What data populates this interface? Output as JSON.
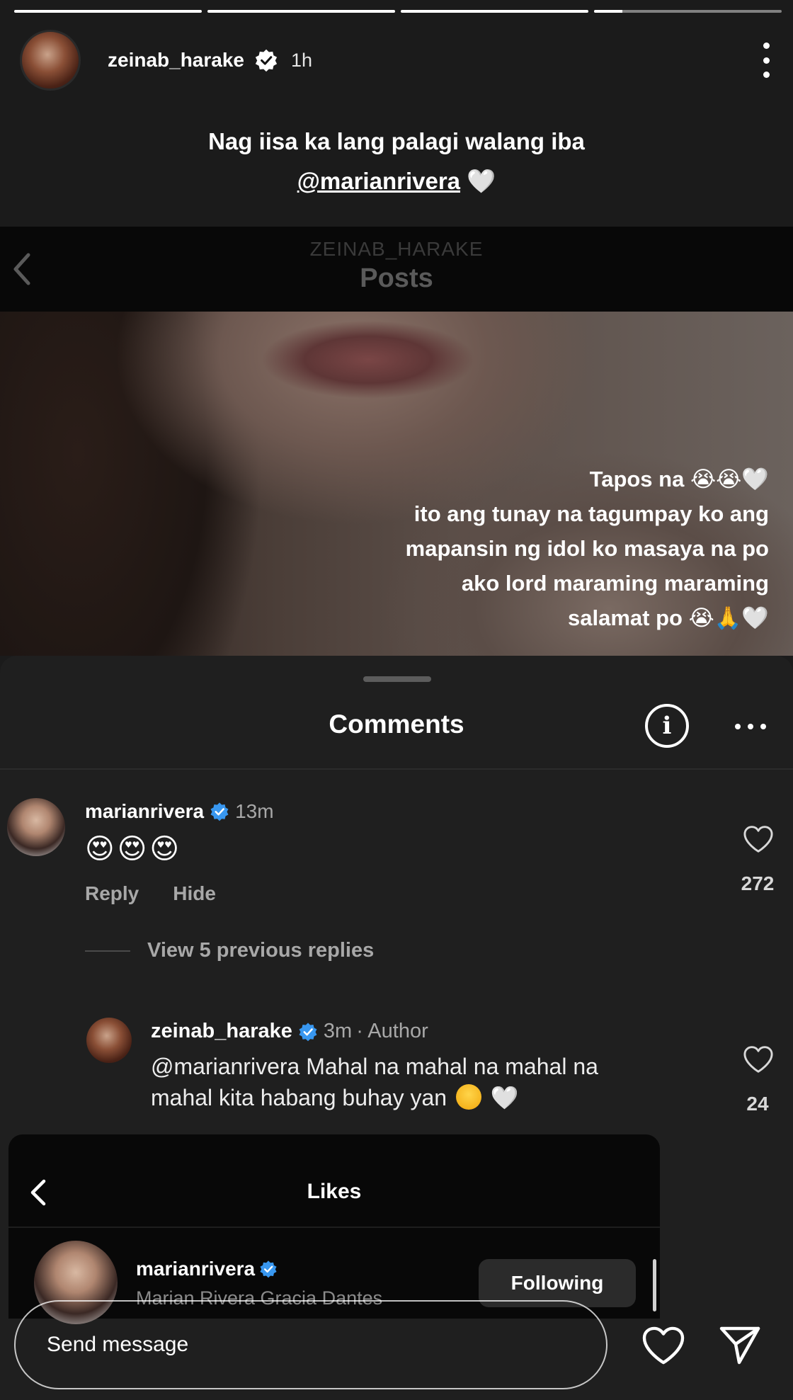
{
  "story": {
    "progress": [
      1,
      1,
      1,
      0.15
    ],
    "username": "zeinab_harake",
    "time": "1h",
    "caption_line1": "Nag iisa ka lang palagi walang iba",
    "caption_mention": "@marianrivera",
    "caption_heart": "🤍"
  },
  "shared_post": {
    "owner": "ZEINAB_HARAKE",
    "title": "Posts",
    "overlay_lines": [
      "Tapos na 😭😭🤍",
      "ito ang tunay na tagumpay ko ang",
      "mapansin ng idol ko masaya na po",
      "ako lord maraming maraming",
      "salamat po 😭🙏🤍"
    ]
  },
  "comments": {
    "title": "Comments",
    "info_icon": "info-circle-icon",
    "first": {
      "username": "marianrivera",
      "time": "13m",
      "emoji_text": "😍😍😍",
      "reply_label": "Reply",
      "hide_label": "Hide",
      "like_count": "272"
    },
    "view_replies": "View 5 previous replies",
    "reply": {
      "username": "zeinab_harake",
      "time": "3m",
      "author_tag": "· Author",
      "text_line1": "@marianrivera Mahal na mahal na mahal na",
      "text_line2": "mahal kita habang buhay yan",
      "text_end": "🤍",
      "like_count": "24"
    }
  },
  "likes_panel": {
    "title": "Likes",
    "user": {
      "username": "marianrivera",
      "full_name": "Marian Rivera Gracia Dantes",
      "button": "Following"
    }
  },
  "reply_bar": {
    "placeholder": "Send message"
  },
  "colors": {
    "background": "#1b1b1b",
    "sheet": "#1f1f1f",
    "secondary_text": "#a8a8a8",
    "verified_blue": "#3897f0"
  }
}
